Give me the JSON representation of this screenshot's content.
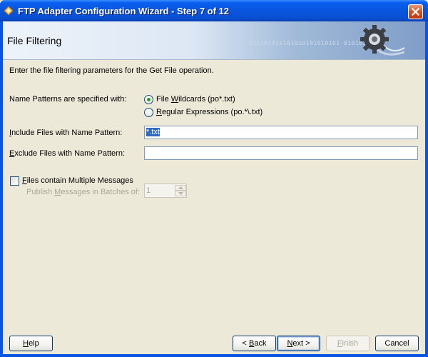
{
  "window": {
    "title": "FTP Adapter Configuration Wizard - Step 7 of 12"
  },
  "header": {
    "title": "File Filtering",
    "binary_text": "010101010101010101010101 01010101"
  },
  "description": "Enter the file filtering parameters for the Get File operation.",
  "name_patterns": {
    "label": "Name Patterns are specified with:",
    "options": [
      {
        "pre": "File ",
        "mnemonic": "W",
        "post": "ildcards (po*.txt)",
        "selected": true
      },
      {
        "pre": "",
        "mnemonic": "R",
        "post": "egular Expressions (po.*\\.txt)",
        "selected": false
      }
    ]
  },
  "include": {
    "label_mnemonic": "I",
    "label_rest": "nclude Files with Name Pattern:",
    "value": "*.txt"
  },
  "exclude": {
    "label_mnemonic": "E",
    "label_rest": "xclude Files with Name Pattern:",
    "value": ""
  },
  "multiple_messages": {
    "label_mnemonic": "F",
    "label_rest": "iles contain Multiple Messages",
    "checked": false
  },
  "batch": {
    "label_pre": "Publish ",
    "label_mnemonic": "M",
    "label_post": "essages in Batches of:",
    "value": "1"
  },
  "buttons": {
    "help": {
      "mnemonic": "H",
      "rest": "elp"
    },
    "back": {
      "pre": "< ",
      "mnemonic": "B",
      "post": "ack"
    },
    "next": {
      "mnemonic": "N",
      "post": "ext >"
    },
    "finish": {
      "mnemonic": "F",
      "post": "inish"
    },
    "cancel": "Cancel"
  },
  "colors": {
    "title_bar": "#0855dd",
    "selection": "#316ac5",
    "window_bg": "#ece9d8"
  }
}
